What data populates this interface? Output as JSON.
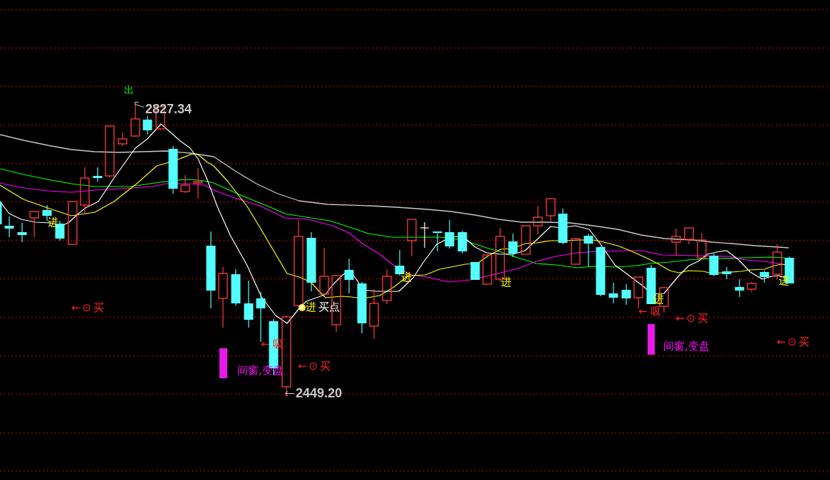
{
  "chart": {
    "extremes": [
      {
        "kind": "high",
        "text": "2827.34"
      },
      {
        "kind": "low",
        "text": "2449.20"
      }
    ],
    "signals": [
      {
        "kind": "entry",
        "text": "进"
      },
      {
        "kind": "buy",
        "text": "←⊙买"
      },
      {
        "kind": "exit",
        "text": "出"
      },
      {
        "kind": "time-window",
        "text": "间窗,变盘"
      },
      {
        "kind": "absorb",
        "text": "←吸"
      },
      {
        "kind": "buy",
        "text": "←⊙买"
      },
      {
        "kind": "entry",
        "text": "进"
      },
      {
        "kind": "buy-point",
        "text": "买点"
      },
      {
        "kind": "entry",
        "text": "进"
      },
      {
        "kind": "entry",
        "text": "进"
      },
      {
        "kind": "absorb",
        "text": "←吸"
      },
      {
        "kind": "time-window",
        "text": "间窗,变盘"
      },
      {
        "kind": "entry",
        "text": "进"
      },
      {
        "kind": "buy",
        "text": "←⊙买"
      },
      {
        "kind": "buy",
        "text": "←⊙买"
      },
      {
        "kind": "entry",
        "text": "进"
      }
    ]
  }
}
